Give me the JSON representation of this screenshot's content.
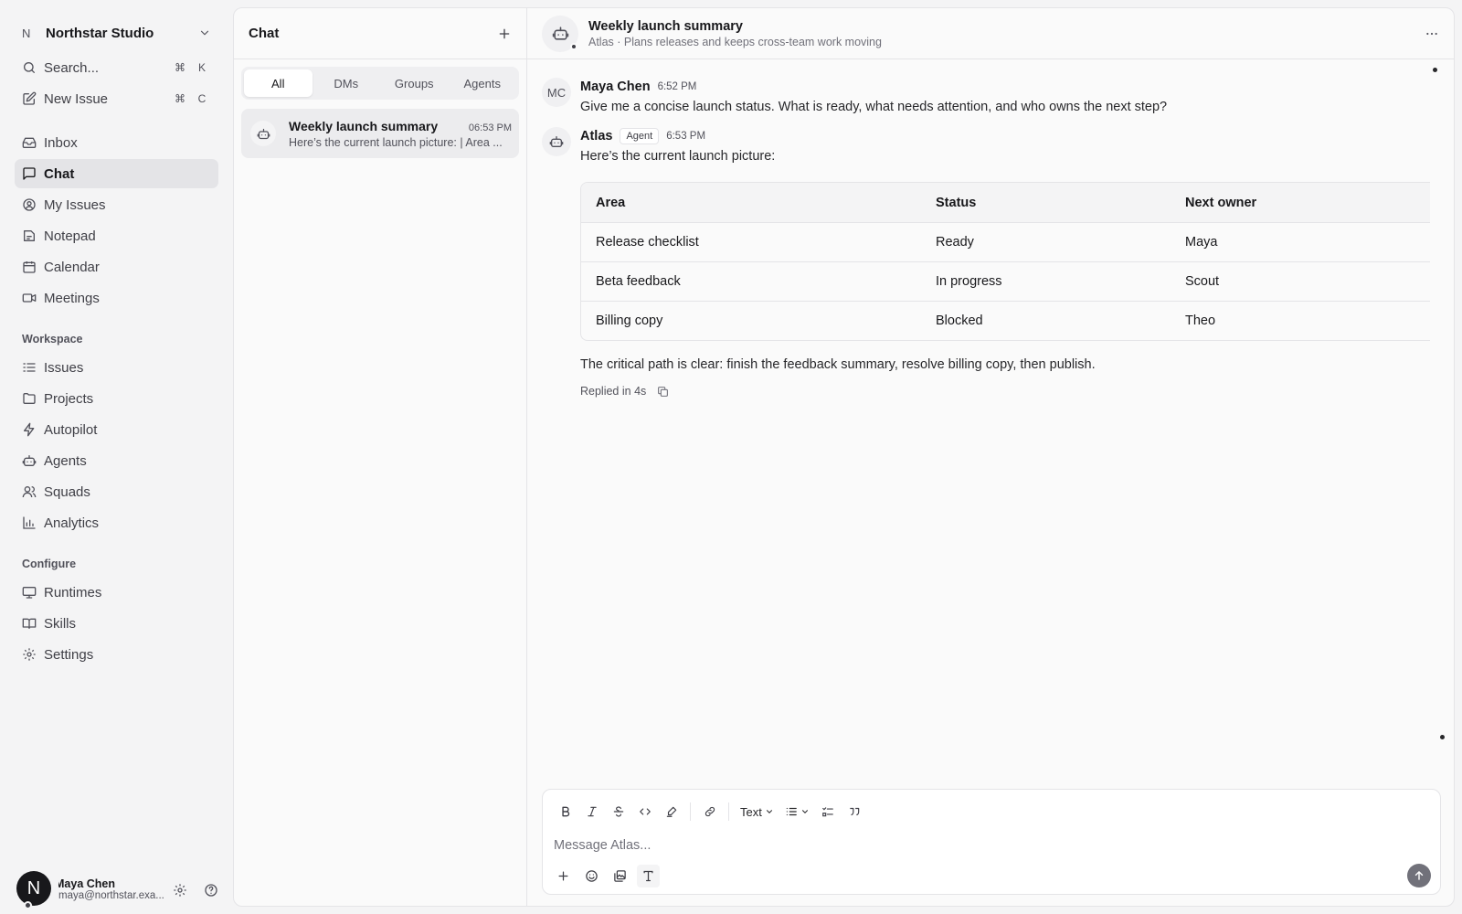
{
  "workspace": {
    "initial": "N",
    "name": "Northstar Studio"
  },
  "nav_top": [
    {
      "label": "Search...",
      "kbd": [
        "⌘",
        "K"
      ],
      "icon": "search-icon"
    },
    {
      "label": "New Issue",
      "kbd": [
        "⌘",
        "C"
      ],
      "icon": "edit-icon"
    }
  ],
  "nav_main": [
    {
      "label": "Inbox",
      "icon": "inbox-icon"
    },
    {
      "label": "Chat",
      "icon": "chat-icon",
      "active": true
    },
    {
      "label": "My Issues",
      "icon": "user-circle-icon"
    },
    {
      "label": "Notepad",
      "icon": "notepad-icon"
    },
    {
      "label": "Calendar",
      "icon": "calendar-icon"
    },
    {
      "label": "Meetings",
      "icon": "video-icon"
    }
  ],
  "workspace_section": {
    "label": "Workspace",
    "items": [
      {
        "label": "Issues",
        "icon": "list-icon"
      },
      {
        "label": "Projects",
        "icon": "folder-icon"
      },
      {
        "label": "Autopilot",
        "icon": "lightning-icon"
      },
      {
        "label": "Agents",
        "icon": "bot-icon"
      },
      {
        "label": "Squads",
        "icon": "users-icon"
      },
      {
        "label": "Analytics",
        "icon": "bar-chart-icon"
      }
    ]
  },
  "configure_section": {
    "label": "Configure",
    "items": [
      {
        "label": "Runtimes",
        "icon": "monitor-icon"
      },
      {
        "label": "Skills",
        "icon": "book-icon"
      },
      {
        "label": "Settings",
        "icon": "gear-icon"
      }
    ]
  },
  "user": {
    "initial": "N",
    "name": "Maya Chen",
    "email": "maya@northstar.exa..."
  },
  "chatlist": {
    "title": "Chat",
    "tabs": [
      "All",
      "DMs",
      "Groups",
      "Agents"
    ],
    "active_tab": 0,
    "conversations": [
      {
        "title": "Weekly launch summary",
        "time": "06:53 PM",
        "preview": "Here’s the current launch picture: | Area ..."
      }
    ]
  },
  "conversation": {
    "title": "Weekly launch summary",
    "subtitle": "Atlas · Plans releases and keeps cross-team work moving",
    "messages": {
      "user": {
        "avatar": "MC",
        "author": "Maya Chen",
        "time": "6:52 PM",
        "text": "Give me a concise launch status. What is ready, what needs attention, and who owns the next step?"
      },
      "agent": {
        "author": "Atlas",
        "badge": "Agent",
        "time": "6:53 PM",
        "intro": "Here’s the current launch picture:",
        "table": {
          "headers": [
            "Area",
            "Status",
            "Next owner"
          ],
          "rows": [
            [
              "Release checklist",
              "Ready",
              "Maya"
            ],
            [
              "Beta feedback",
              "In progress",
              "Scout"
            ],
            [
              "Billing copy",
              "Blocked",
              "Theo"
            ]
          ]
        },
        "outro": "The critical path is clear: finish the feedback summary, resolve billing copy, then publish.",
        "footer": "Replied in 4s"
      }
    }
  },
  "composer": {
    "text_style": "Text",
    "placeholder": "Message Atlas..."
  }
}
